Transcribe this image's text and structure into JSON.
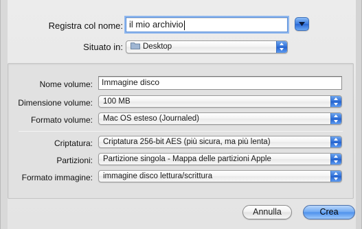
{
  "dialog": {
    "save_as_label": "Registra col nome:",
    "save_as_value": "il mio archivio",
    "where_label": "Situato in:",
    "where_value": "Desktop",
    "where_icon": "folder-icon"
  },
  "options": {
    "volume_name_label": "Nome volume:",
    "volume_name_value": "Immagine disco",
    "volume_size_label": "Dimensione volume:",
    "volume_size_value": "100 MB",
    "volume_format_label": "Formato volume:",
    "volume_format_value": "Mac OS esteso (Journaled)",
    "encryption_label": "Criptatura:",
    "encryption_value": "Criptatura 256-bit AES (più sicura, ma più lenta)",
    "partitions_label": "Partizioni:",
    "partitions_value": "Partizione singola - Mappa delle partizioni Apple",
    "image_format_label": "Formato immagine:",
    "image_format_value": "immagine disco lettura/scrittura"
  },
  "buttons": {
    "cancel": "Annulla",
    "create": "Crea"
  },
  "colors": {
    "accent": "#3b7be0",
    "focus_ring": "#8fb7ee"
  }
}
